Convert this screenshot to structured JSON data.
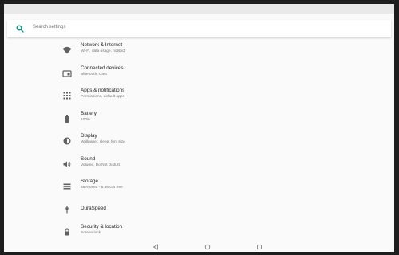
{
  "search": {
    "placeholder": "Search settings"
  },
  "settings": {
    "items": [
      {
        "title": "Network & Internet",
        "subtitle": "Wi-Fi, data usage, hotspot",
        "icon": "wifi-icon"
      },
      {
        "title": "Connected devices",
        "subtitle": "Bluetooth, Cast",
        "icon": "connected-devices-icon"
      },
      {
        "title": "Apps & notifications",
        "subtitle": "Permissions, default apps",
        "icon": "apps-icon"
      },
      {
        "title": "Battery",
        "subtitle": "100%",
        "icon": "battery-icon"
      },
      {
        "title": "Display",
        "subtitle": "Wallpaper, sleep, font size",
        "icon": "display-icon"
      },
      {
        "title": "Sound",
        "subtitle": "Volume, Do Not Disturb",
        "icon": "sound-icon"
      },
      {
        "title": "Storage",
        "subtitle": "68% used - 8.38 GB free",
        "icon": "storage-icon"
      },
      {
        "title": "DuraSpeed",
        "subtitle": "",
        "icon": "duraspeed-icon"
      },
      {
        "title": "Security & location",
        "subtitle": "Screen lock",
        "icon": "lock-icon"
      }
    ]
  },
  "nav": {
    "buttons": [
      "back-button",
      "home-button",
      "recents-button"
    ]
  },
  "colors": {
    "accent": "#009688",
    "icon": "#616161",
    "background": "#fafafa"
  }
}
